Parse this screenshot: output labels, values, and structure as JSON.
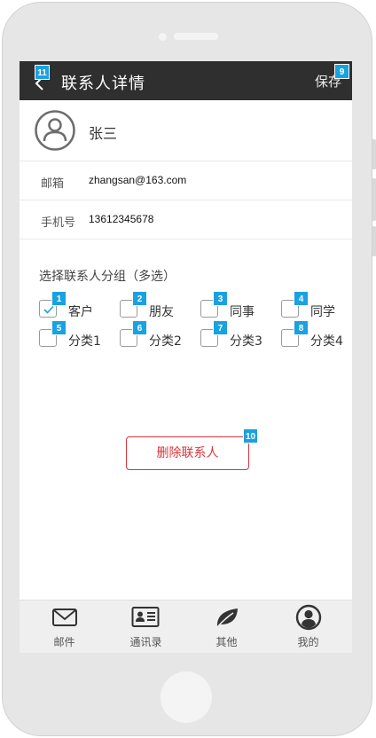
{
  "header": {
    "title": "联系人详情",
    "save_label": "保存",
    "back_badge": "11",
    "save_badge": "9"
  },
  "contact": {
    "name": "张三",
    "email_label": "邮箱",
    "email_value": "zhangsan@163.com",
    "phone_label": "手机号",
    "phone_value": "13612345678"
  },
  "groups": {
    "title": "选择联系人分组（多选）",
    "items": [
      {
        "label": "客户",
        "badge": "1",
        "checked": true
      },
      {
        "label": "朋友",
        "badge": "2",
        "checked": false
      },
      {
        "label": "同事",
        "badge": "3",
        "checked": false
      },
      {
        "label": "同学",
        "badge": "4",
        "checked": false
      },
      {
        "label": "分类1",
        "badge": "5",
        "checked": false
      },
      {
        "label": "分类2",
        "badge": "6",
        "checked": false
      },
      {
        "label": "分类3",
        "badge": "7",
        "checked": false
      },
      {
        "label": "分类4",
        "badge": "8",
        "checked": false
      }
    ]
  },
  "delete": {
    "label": "删除联系人",
    "badge": "10"
  },
  "tabbar": {
    "items": [
      {
        "label": "邮件",
        "icon": "mail-icon"
      },
      {
        "label": "通讯录",
        "icon": "contacts-card-icon"
      },
      {
        "label": "其他",
        "icon": "leaf-icon"
      },
      {
        "label": "我的",
        "icon": "user-profile-icon"
      }
    ]
  },
  "colors": {
    "navbar": "#2f2f2f",
    "badge": "#1aa1e0",
    "danger": "#d9343a",
    "check": "#1aa1e0"
  }
}
